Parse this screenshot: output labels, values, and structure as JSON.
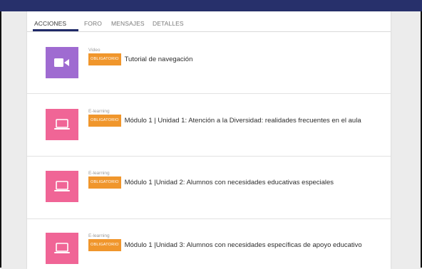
{
  "tabs": [
    {
      "label": "ACCIONES"
    },
    {
      "label": "FORO"
    },
    {
      "label": "MENSAJES"
    },
    {
      "label": "DETALLES"
    }
  ],
  "colors": {
    "topbar": "#27306b",
    "video_icon_bg": "#9f6bd1",
    "elearning_icon_bg": "#f06596",
    "badge": "#f0962c"
  },
  "items": [
    {
      "type_label": "Video",
      "badge": "OBLIGATORIO",
      "title": "Tutorial de navegación",
      "icon": "video-camera-icon"
    },
    {
      "type_label": "E-learning",
      "badge": "OBLIGATORIO",
      "title": "Módulo 1 | Unidad 1: Atención a la Diversidad: realidades frecuentes en el aula",
      "icon": "laptop-icon"
    },
    {
      "type_label": "E-learning",
      "badge": "OBLIGATORIO",
      "title": "Módulo 1 |Unidad 2: Alumnos con necesidades educativas especiales",
      "icon": "laptop-icon"
    },
    {
      "type_label": "E-learning",
      "badge": "OBLIGATORIO",
      "title": "Módulo 1 |Unidad 3: Alumnos con necesidades específicas de apoyo educativo",
      "icon": "laptop-icon"
    }
  ]
}
